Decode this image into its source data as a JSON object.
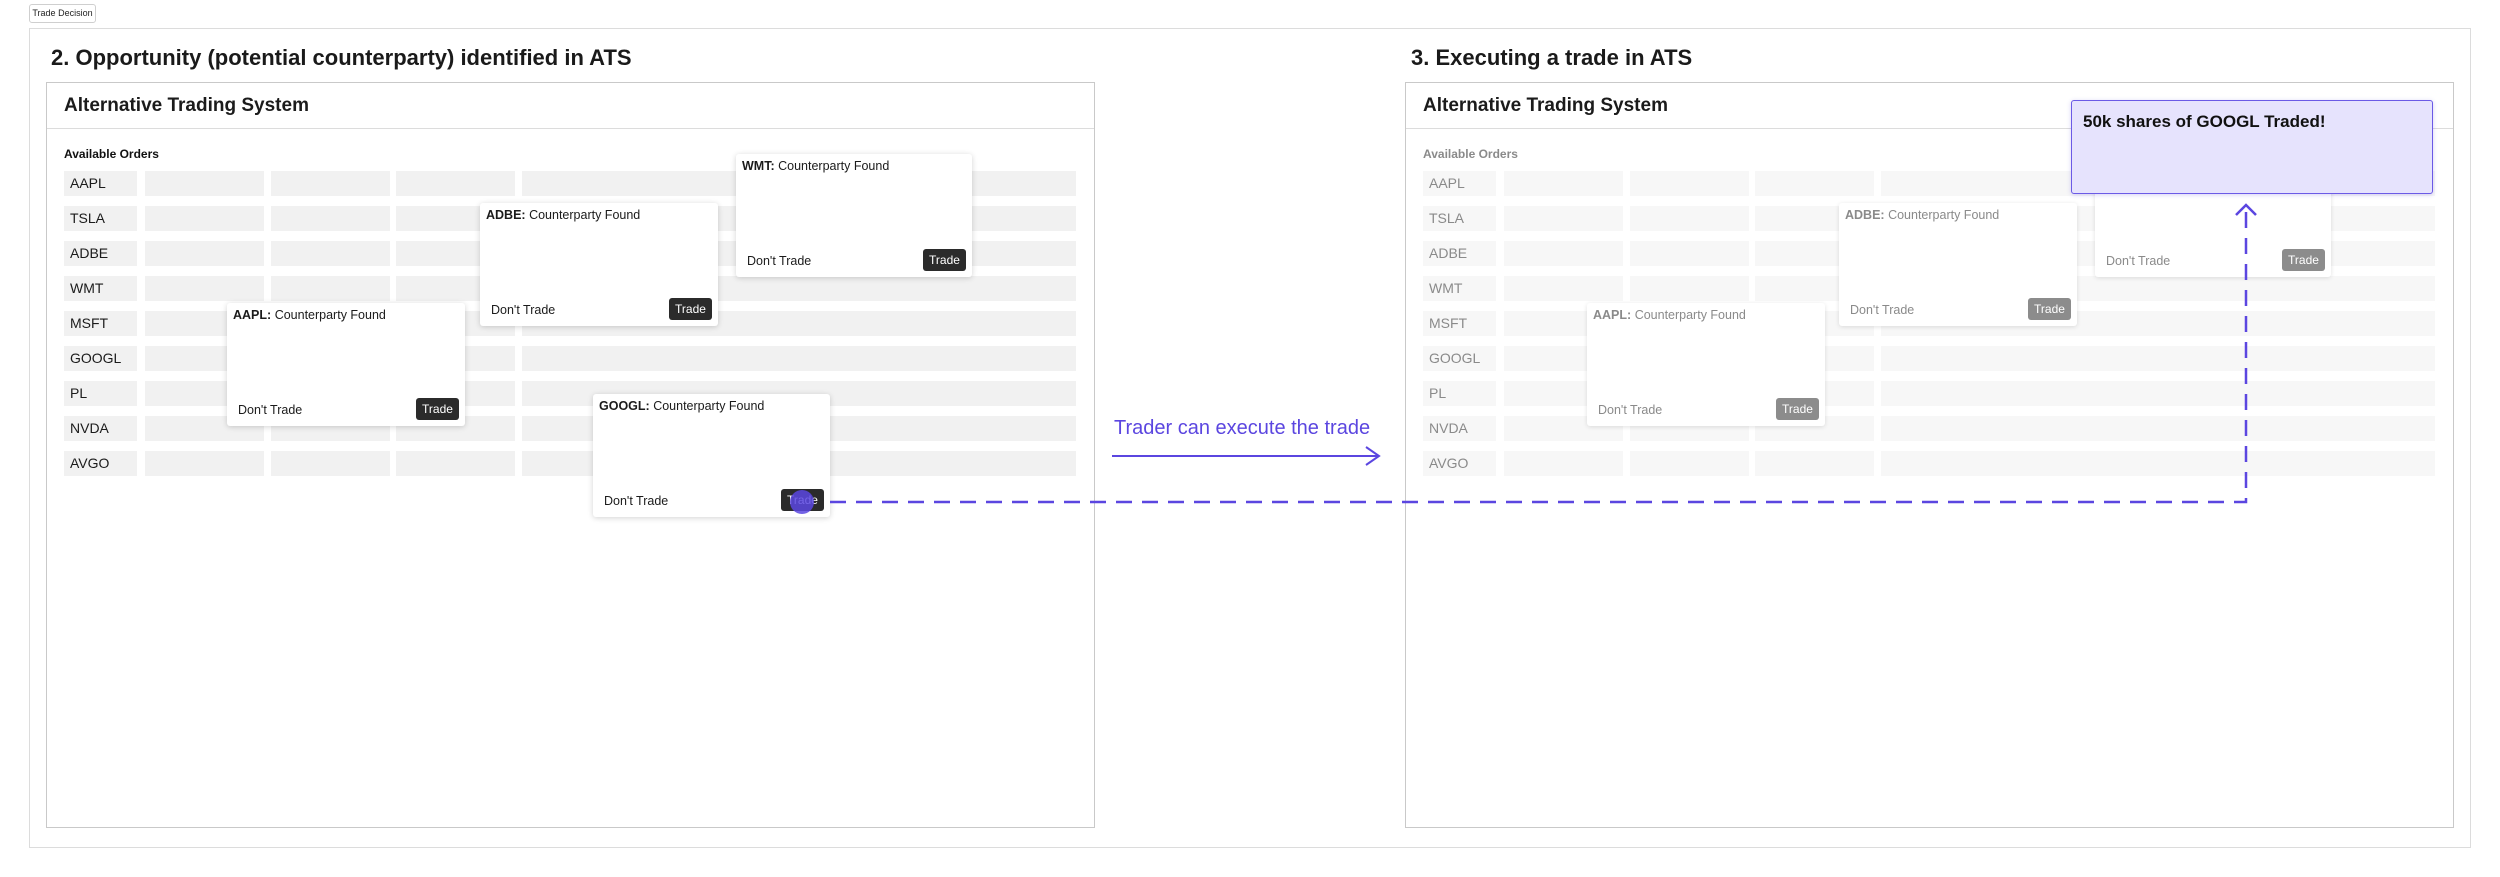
{
  "tag_label": "Trade Decision",
  "left": {
    "section_title": "2. Opportunity (potential counterparty) identified in ATS",
    "panel_title": "Alternative Trading System",
    "available_label": "Available Orders"
  },
  "right": {
    "section_title": "3. Executing a trade in ATS",
    "panel_title": "Alternative Trading System",
    "available_label": "Available Orders"
  },
  "symbols": [
    "AAPL",
    "TSLA",
    "ADBE",
    "WMT",
    "MSFT",
    "GOOGL",
    "PL",
    "NVDA",
    "AVGO"
  ],
  "cards": {
    "wmt": {
      "symbol": "WMT:",
      "text": "Counterparty Found"
    },
    "adbe": {
      "symbol": "ADBE:",
      "text": "Counterparty Found"
    },
    "aapl": {
      "symbol": "AAPL:",
      "text": "Counterparty Found"
    },
    "googl": {
      "symbol": "GOOGL:",
      "text": "Counterparty Found"
    }
  },
  "dont_trade_label": "Don't Trade",
  "trade_label": "Trade",
  "arrow_label": "Trader can execute the trade",
  "traded_message": "50k shares of GOOGL Traded!",
  "colors": {
    "accent": "#5b46e0",
    "traded_bg": "#e6e3fd",
    "button": "#2b2b2b"
  }
}
